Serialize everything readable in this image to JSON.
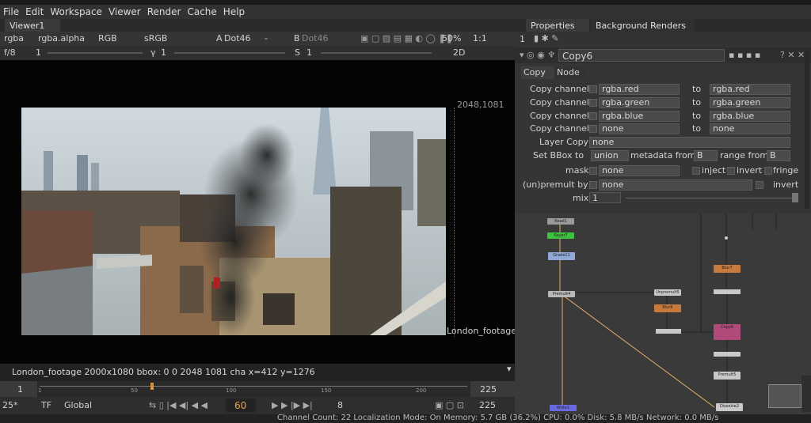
{
  "menu": [
    "File",
    "Edit",
    "Workspace",
    "Viewer",
    "Render",
    "Cache",
    "Help"
  ],
  "viewer": {
    "tab": "Viewer1",
    "channels": "rgba",
    "alpha": "rgba.alpha",
    "colorspace_display": "RGB",
    "lut": "sRGB",
    "input_a_label": "A",
    "input_a": "Dot46",
    "wipe": "-",
    "input_b_label": "B",
    "input_b": "Dot46",
    "zoom": "50%",
    "proxy": "1:1",
    "fstop_label": "f/8",
    "fstop_value": "1",
    "gamma_label": "γ",
    "gamma_value": "1",
    "saturation_label": "S",
    "saturation_value": "1",
    "view_mode": "2D",
    "resolution_corner": "2048,1081",
    "overlay_name": "London_footage",
    "info": "London_footage 2000x1080  bbox: 0 0 2048 1081 cha x=412 y=1276"
  },
  "timeline": {
    "start": "1",
    "end": "225",
    "ticks": [
      "1",
      "50",
      "100",
      "150",
      "200"
    ],
    "current_frame": "60",
    "fps": "25*",
    "tf": "TF",
    "scope": "Global",
    "step": "8",
    "out_frame": "225"
  },
  "status": "Channel Count: 22  Localization Mode: On  Memory: 5.7 GB (36.2%)  CPU: 0.0%  Disk: 5.8 MB/s  Network: 0.0 MB/s",
  "properties": {
    "tab_properties": "Properties",
    "tab_background": "Background Renders",
    "count": "1",
    "node_name": "Copy6",
    "subtab_copy": "Copy",
    "subtab_node": "Node",
    "copy_rows": [
      {
        "label": "Copy channel",
        "from": "rgba.red",
        "to_label": "to",
        "to": "rgba.red"
      },
      {
        "label": "Copy channel",
        "from": "rgba.green",
        "to_label": "to",
        "to": "rgba.green"
      },
      {
        "label": "Copy channel",
        "from": "rgba.blue",
        "to_label": "to",
        "to": "rgba.blue"
      },
      {
        "label": "Copy channel",
        "from": "none",
        "to_label": "to",
        "to": "none"
      }
    ],
    "layer_copy_label": "Layer Copy",
    "layer_copy_value": "none",
    "bbox_label": "Set BBox to",
    "bbox_value": "union",
    "metadata_label": "metadata from",
    "metadata_value": "B",
    "range_label": "range from",
    "range_value": "B",
    "mask_label": "mask",
    "mask_value": "none",
    "inject": "inject",
    "invert": "invert",
    "fringe": "fringe",
    "unpremult_label": "(un)premult by",
    "unpremult_value": "none",
    "unpremult_invert": "invert",
    "mix_label": "mix",
    "mix_value": "1"
  },
  "nodes": [
    {
      "name": "Read1 (London_foot...mp4)",
      "color": "#9a9a9a"
    },
    {
      "name": "Keyer7 (luminance key)",
      "color": "#3ec13e"
    },
    {
      "name": "Grade11",
      "color": "#8fa8d8"
    },
    {
      "name": "Premult4",
      "color": "#b8b8b8"
    },
    {
      "name": "Unpremult5",
      "color": "#c8c8c8"
    },
    {
      "name": "Blur6",
      "color": "#c87a3c"
    },
    {
      "name": "Blur7",
      "color": "#c87a3c"
    },
    {
      "name": "Copy6",
      "color": "#b04a7a"
    },
    {
      "name": "Premult5",
      "color": "#c8c8c8"
    },
    {
      "name": "Dissolve2",
      "color": "#c8c8c8"
    },
    {
      "name": "Write1",
      "color": "#6a6ae0"
    }
  ]
}
